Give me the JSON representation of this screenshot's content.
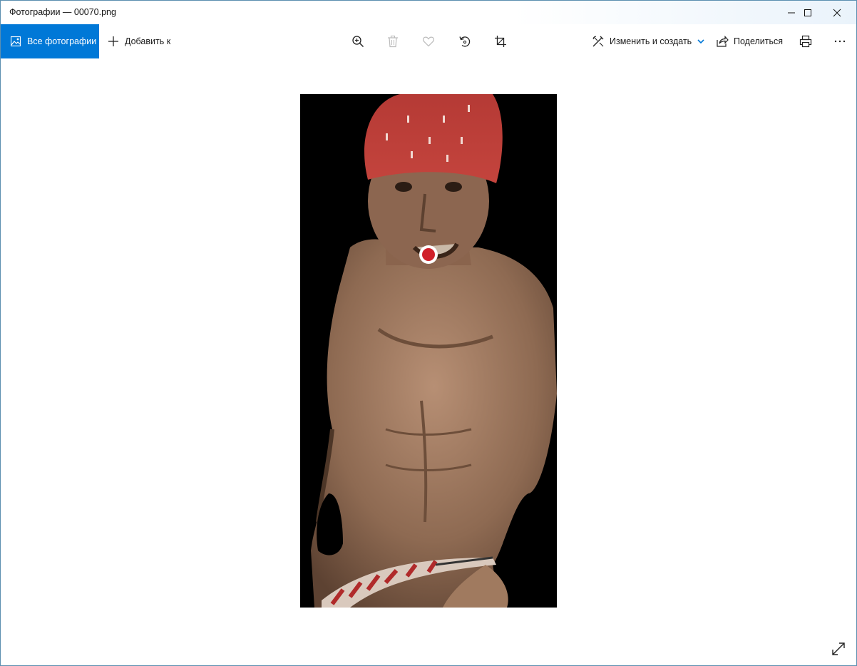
{
  "window": {
    "title": "Фотографии — 00070.png",
    "controls": {
      "minimize": "minimize-icon",
      "maximize": "maximize-icon",
      "close": "close-icon"
    }
  },
  "toolbar": {
    "all_photos_label": "Все фотографии",
    "add_to_label": "Добавить к",
    "edit_create_label": "Изменить и создать",
    "share_label": "Поделиться",
    "icons": [
      "zoom-in-icon",
      "delete-icon",
      "favorite-icon",
      "rotate-icon",
      "crop-icon",
      "print-icon",
      "more-icon"
    ]
  },
  "viewer": {
    "photo": "shirtless-man-red-bandana",
    "marker": "red-dot-marker",
    "expand": "expand-icon"
  },
  "colors": {
    "accent": "#0078d7",
    "photo_background": "#000000",
    "marker": "#d0202a"
  }
}
